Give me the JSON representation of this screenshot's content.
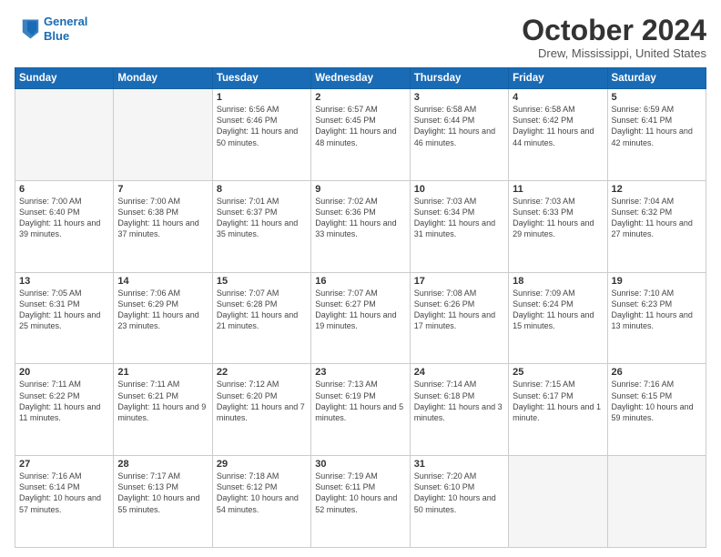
{
  "header": {
    "logo_line1": "General",
    "logo_line2": "Blue",
    "month_title": "October 2024",
    "location": "Drew, Mississippi, United States"
  },
  "days_of_week": [
    "Sunday",
    "Monday",
    "Tuesday",
    "Wednesday",
    "Thursday",
    "Friday",
    "Saturday"
  ],
  "weeks": [
    [
      {
        "day": "",
        "info": ""
      },
      {
        "day": "",
        "info": ""
      },
      {
        "day": "1",
        "info": "Sunrise: 6:56 AM\nSunset: 6:46 PM\nDaylight: 11 hours and 50 minutes."
      },
      {
        "day": "2",
        "info": "Sunrise: 6:57 AM\nSunset: 6:45 PM\nDaylight: 11 hours and 48 minutes."
      },
      {
        "day": "3",
        "info": "Sunrise: 6:58 AM\nSunset: 6:44 PM\nDaylight: 11 hours and 46 minutes."
      },
      {
        "day": "4",
        "info": "Sunrise: 6:58 AM\nSunset: 6:42 PM\nDaylight: 11 hours and 44 minutes."
      },
      {
        "day": "5",
        "info": "Sunrise: 6:59 AM\nSunset: 6:41 PM\nDaylight: 11 hours and 42 minutes."
      }
    ],
    [
      {
        "day": "6",
        "info": "Sunrise: 7:00 AM\nSunset: 6:40 PM\nDaylight: 11 hours and 39 minutes."
      },
      {
        "day": "7",
        "info": "Sunrise: 7:00 AM\nSunset: 6:38 PM\nDaylight: 11 hours and 37 minutes."
      },
      {
        "day": "8",
        "info": "Sunrise: 7:01 AM\nSunset: 6:37 PM\nDaylight: 11 hours and 35 minutes."
      },
      {
        "day": "9",
        "info": "Sunrise: 7:02 AM\nSunset: 6:36 PM\nDaylight: 11 hours and 33 minutes."
      },
      {
        "day": "10",
        "info": "Sunrise: 7:03 AM\nSunset: 6:34 PM\nDaylight: 11 hours and 31 minutes."
      },
      {
        "day": "11",
        "info": "Sunrise: 7:03 AM\nSunset: 6:33 PM\nDaylight: 11 hours and 29 minutes."
      },
      {
        "day": "12",
        "info": "Sunrise: 7:04 AM\nSunset: 6:32 PM\nDaylight: 11 hours and 27 minutes."
      }
    ],
    [
      {
        "day": "13",
        "info": "Sunrise: 7:05 AM\nSunset: 6:31 PM\nDaylight: 11 hours and 25 minutes."
      },
      {
        "day": "14",
        "info": "Sunrise: 7:06 AM\nSunset: 6:29 PM\nDaylight: 11 hours and 23 minutes."
      },
      {
        "day": "15",
        "info": "Sunrise: 7:07 AM\nSunset: 6:28 PM\nDaylight: 11 hours and 21 minutes."
      },
      {
        "day": "16",
        "info": "Sunrise: 7:07 AM\nSunset: 6:27 PM\nDaylight: 11 hours and 19 minutes."
      },
      {
        "day": "17",
        "info": "Sunrise: 7:08 AM\nSunset: 6:26 PM\nDaylight: 11 hours and 17 minutes."
      },
      {
        "day": "18",
        "info": "Sunrise: 7:09 AM\nSunset: 6:24 PM\nDaylight: 11 hours and 15 minutes."
      },
      {
        "day": "19",
        "info": "Sunrise: 7:10 AM\nSunset: 6:23 PM\nDaylight: 11 hours and 13 minutes."
      }
    ],
    [
      {
        "day": "20",
        "info": "Sunrise: 7:11 AM\nSunset: 6:22 PM\nDaylight: 11 hours and 11 minutes."
      },
      {
        "day": "21",
        "info": "Sunrise: 7:11 AM\nSunset: 6:21 PM\nDaylight: 11 hours and 9 minutes."
      },
      {
        "day": "22",
        "info": "Sunrise: 7:12 AM\nSunset: 6:20 PM\nDaylight: 11 hours and 7 minutes."
      },
      {
        "day": "23",
        "info": "Sunrise: 7:13 AM\nSunset: 6:19 PM\nDaylight: 11 hours and 5 minutes."
      },
      {
        "day": "24",
        "info": "Sunrise: 7:14 AM\nSunset: 6:18 PM\nDaylight: 11 hours and 3 minutes."
      },
      {
        "day": "25",
        "info": "Sunrise: 7:15 AM\nSunset: 6:17 PM\nDaylight: 11 hours and 1 minute."
      },
      {
        "day": "26",
        "info": "Sunrise: 7:16 AM\nSunset: 6:15 PM\nDaylight: 10 hours and 59 minutes."
      }
    ],
    [
      {
        "day": "27",
        "info": "Sunrise: 7:16 AM\nSunset: 6:14 PM\nDaylight: 10 hours and 57 minutes."
      },
      {
        "day": "28",
        "info": "Sunrise: 7:17 AM\nSunset: 6:13 PM\nDaylight: 10 hours and 55 minutes."
      },
      {
        "day": "29",
        "info": "Sunrise: 7:18 AM\nSunset: 6:12 PM\nDaylight: 10 hours and 54 minutes."
      },
      {
        "day": "30",
        "info": "Sunrise: 7:19 AM\nSunset: 6:11 PM\nDaylight: 10 hours and 52 minutes."
      },
      {
        "day": "31",
        "info": "Sunrise: 7:20 AM\nSunset: 6:10 PM\nDaylight: 10 hours and 50 minutes."
      },
      {
        "day": "",
        "info": ""
      },
      {
        "day": "",
        "info": ""
      }
    ]
  ]
}
